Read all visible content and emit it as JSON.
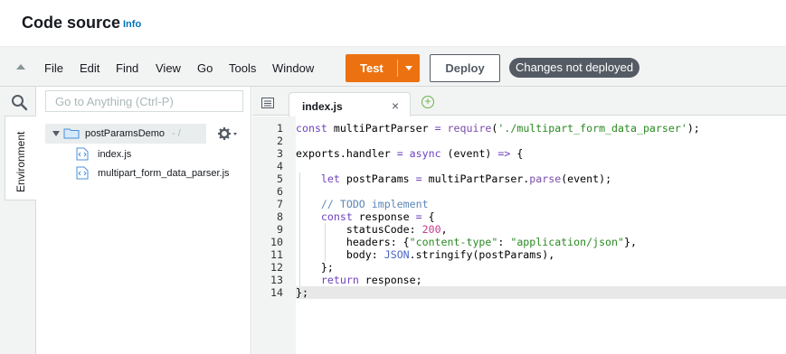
{
  "header": {
    "title": "Code source",
    "info_link": "Info"
  },
  "menubar": {
    "items": [
      "File",
      "Edit",
      "Find",
      "View",
      "Go",
      "Tools",
      "Window"
    ],
    "test_label": "Test",
    "deploy_label": "Deploy",
    "status_badge": "Changes not deployed",
    "accent_color": "#ec7211"
  },
  "sidebar": {
    "tabs": [
      "Environment"
    ],
    "search_placeholder": "Go to Anything (Ctrl-P)"
  },
  "file_tree": {
    "folder": {
      "name": "postParamsDemo",
      "suffix": "- /"
    },
    "files": [
      "index.js",
      "multipart_form_data_parser.js"
    ]
  },
  "editor": {
    "open_tab": "index.js",
    "close_symbol": "×",
    "new_tab_symbol": "+",
    "active_line": 14,
    "line_numbers": [
      "1",
      "2",
      "3",
      "4",
      "5",
      "6",
      "7",
      "8",
      "9",
      "10",
      "11",
      "12",
      "13",
      "14"
    ],
    "lines": [
      "const multiPartParser = require('./multipart_form_data_parser');",
      "",
      "exports.handler = async (event) => {",
      "",
      "    let postParams = multiPartParser.parse(event);",
      "",
      "    // TODO implement",
      "    const response = {",
      "        statusCode: 200,",
      "        headers: {\"content-type\": \"application/json\"},",
      "        body: JSON.stringify(postParams),",
      "    };",
      "    return response;",
      "};"
    ]
  }
}
